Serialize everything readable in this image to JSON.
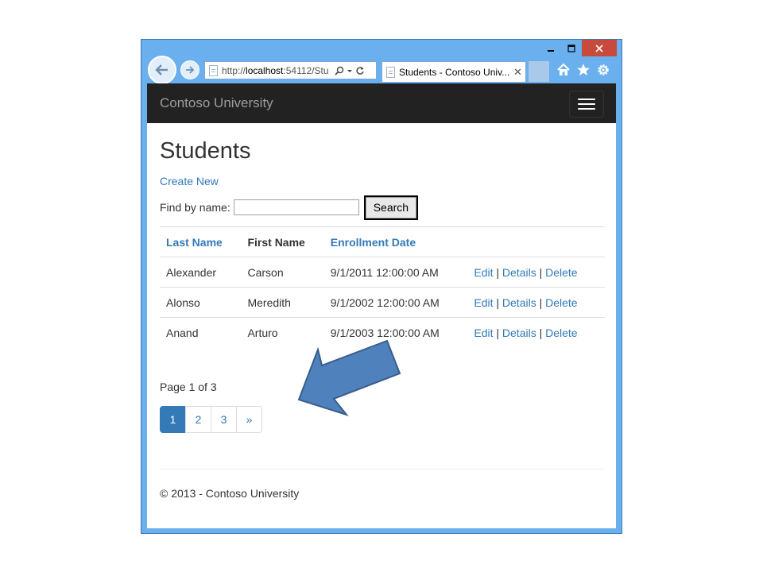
{
  "browser": {
    "url_scheme": "http://",
    "url_host": "localhost",
    "url_rest": ":54112/Stu",
    "tab_title": "Students - Contoso Univ...",
    "tab_close": "✕",
    "accent": "#6ab0ee",
    "close_color": "#c74a3c"
  },
  "site": {
    "brand": "Contoso University"
  },
  "page": {
    "title": "Students",
    "create_link": "Create New",
    "find_label": "Find by name:",
    "search_value": "",
    "search_button": "Search"
  },
  "table": {
    "headers": [
      "Last Name",
      "First Name",
      "Enrollment Date"
    ],
    "rows": [
      {
        "last": "Alexander",
        "first": "Carson",
        "date": "9/1/2011 12:00:00 AM"
      },
      {
        "last": "Alonso",
        "first": "Meredith",
        "date": "9/1/2002 12:00:00 AM"
      },
      {
        "last": "Anand",
        "first": "Arturo",
        "date": "9/1/2003 12:00:00 AM"
      }
    ],
    "actions": {
      "edit": "Edit",
      "details": "Details",
      "delete": "Delete",
      "separator": "|"
    }
  },
  "pagination": {
    "info": "Page 1 of 3",
    "pages": [
      "1",
      "2",
      "3",
      "»"
    ],
    "active": "1"
  },
  "footer": {
    "text": "© 2013 - Contoso University"
  },
  "colors": {
    "link": "#337ab7",
    "navbar": "#222222",
    "callout_arrow": "#4f81bd"
  }
}
